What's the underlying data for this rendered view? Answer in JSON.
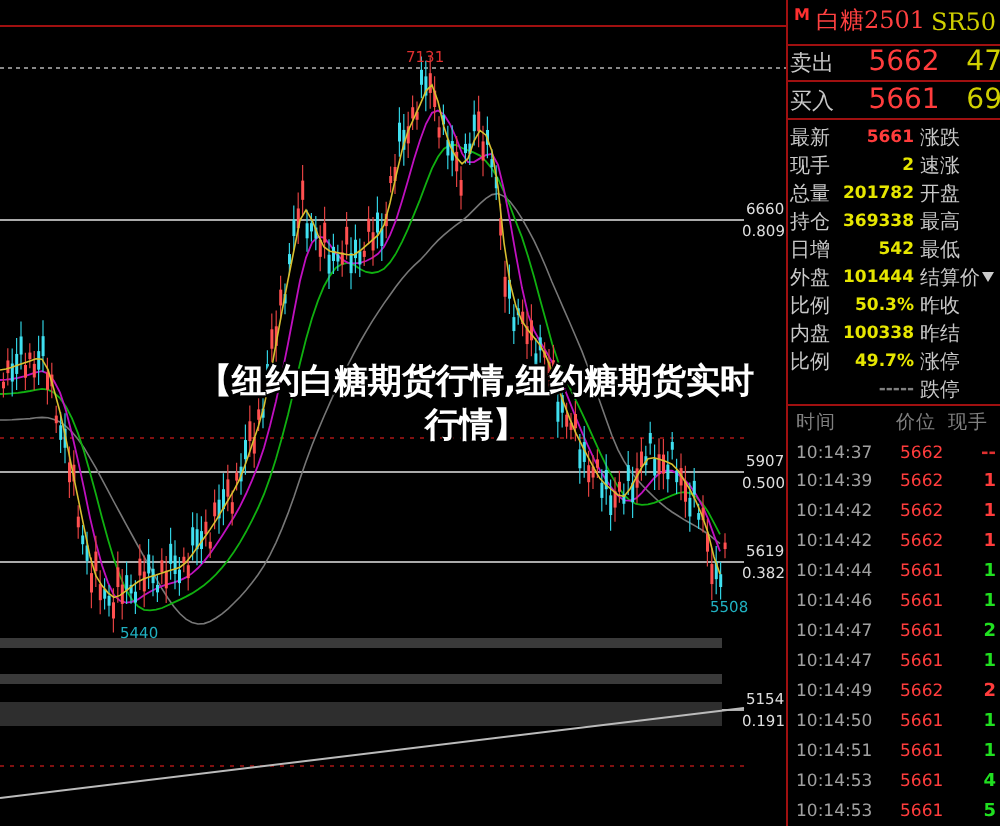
{
  "chart": {
    "extremes": [
      {
        "text": "7131",
        "kind": "high"
      },
      {
        "text": "5440",
        "kind": "low"
      },
      {
        "text": "5508",
        "kind": "low"
      }
    ],
    "levels": [
      {
        "price": "6660",
        "ratio": "0.809"
      },
      {
        "price": "5907",
        "ratio": "0.500"
      },
      {
        "price": "5619",
        "ratio": "0.382"
      },
      {
        "price": "5154",
        "ratio": "0.191"
      }
    ]
  },
  "overlay_title": "【纽约白糖期货行情,纽约糖期货实时行情】",
  "quote": {
    "badge": "M",
    "name": "白糖2501",
    "code": "SR50",
    "book": [
      {
        "label": "卖出",
        "price": "5662",
        "size": "47"
      },
      {
        "label": "买入",
        "price": "5661",
        "size": "69"
      }
    ],
    "stats": [
      {
        "label": "最新",
        "value": "5661",
        "color": "#ff3c3c",
        "right_label": "涨跌"
      },
      {
        "label": "现手",
        "value": "2",
        "color": "#e6e600",
        "right_label": "速涨"
      },
      {
        "label": "总量",
        "value": "201782",
        "color": "#e6e600",
        "right_label": "开盘"
      },
      {
        "label": "持仓",
        "value": "369338",
        "color": "#e6e600",
        "right_label": "最高"
      },
      {
        "label": "日增",
        "value": "542",
        "color": "#e6e600",
        "right_label": "最低"
      },
      {
        "label": "外盘",
        "value": "101444",
        "color": "#e6e600",
        "right_label": "结算价",
        "caret": true
      },
      {
        "label": "比例",
        "value": "50.3%",
        "color": "#e6e600",
        "right_label": "昨收"
      },
      {
        "label": "内盘",
        "value": "100338",
        "color": "#e6e600",
        "right_label": "昨结"
      },
      {
        "label": "比例",
        "value": "49.7%",
        "color": "#e6e600",
        "right_label": "涨停"
      },
      {
        "value": "-----",
        "color": "#808080",
        "right_label": "跌停"
      }
    ]
  },
  "trades": {
    "columns": [
      "时间",
      "价位",
      "现手"
    ],
    "rows": [
      {
        "time": "10:14:37",
        "price": "5662",
        "volume": "--",
        "color": "#e03030"
      },
      {
        "time": "10:14:39",
        "price": "5662",
        "volume": "1",
        "color": "#ff3c3c"
      },
      {
        "time": "10:14:42",
        "price": "5662",
        "volume": "1",
        "color": "#ff3c3c"
      },
      {
        "time": "10:14:42",
        "price": "5662",
        "volume": "1",
        "color": "#ff3c3c"
      },
      {
        "time": "10:14:44",
        "price": "5661",
        "volume": "1",
        "color": "#20e020"
      },
      {
        "time": "10:14:46",
        "price": "5661",
        "volume": "1",
        "color": "#20e020"
      },
      {
        "time": "10:14:47",
        "price": "5661",
        "volume": "2",
        "color": "#20e020"
      },
      {
        "time": "10:14:47",
        "price": "5661",
        "volume": "1",
        "color": "#20e020"
      },
      {
        "time": "10:14:49",
        "price": "5662",
        "volume": "2",
        "color": "#ff3c3c"
      },
      {
        "time": "10:14:50",
        "price": "5661",
        "volume": "1",
        "color": "#20e020"
      },
      {
        "time": "10:14:51",
        "price": "5661",
        "volume": "1",
        "color": "#20e020"
      },
      {
        "time": "10:14:53",
        "price": "5661",
        "volume": "4",
        "color": "#20e020"
      },
      {
        "time": "10:14:53",
        "price": "5661",
        "volume": "5",
        "color": "#20e020"
      }
    ]
  }
}
